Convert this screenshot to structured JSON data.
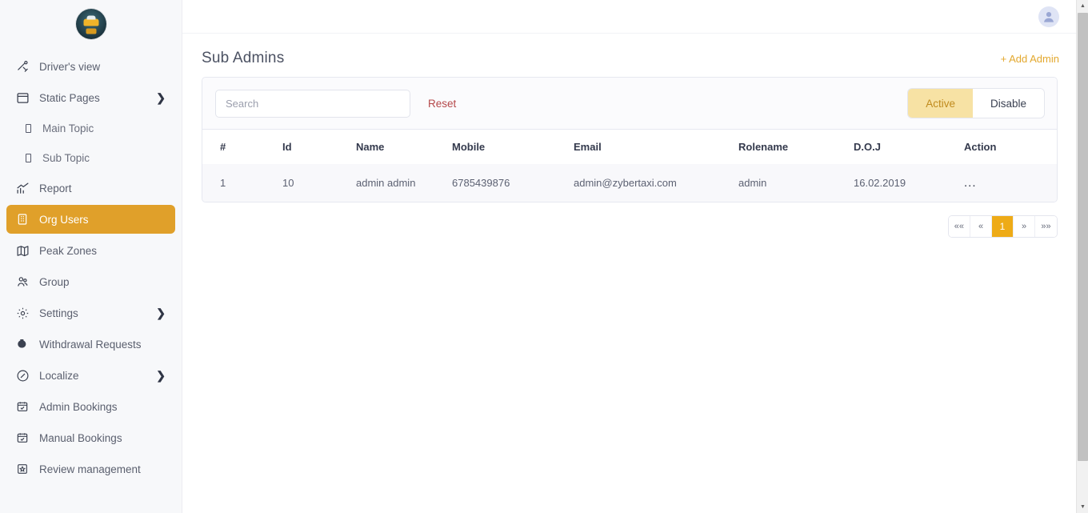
{
  "sidebar": {
    "logo_alt": "taxi-logo",
    "items": [
      {
        "label": "Driver's view",
        "icon": "driver-icon",
        "active": false,
        "expandable": false
      },
      {
        "label": "Static Pages",
        "icon": "pages-icon",
        "active": false,
        "expandable": true
      },
      {
        "label": "Main Topic",
        "icon": "topic-icon",
        "sub": true
      },
      {
        "label": "Sub Topic",
        "icon": "topic-icon",
        "sub": true
      },
      {
        "label": "Report",
        "icon": "chart-icon",
        "active": false,
        "expandable": false
      },
      {
        "label": "Org Users",
        "icon": "building-icon",
        "active": true,
        "expandable": false
      },
      {
        "label": "Peak Zones",
        "icon": "map-icon",
        "active": false,
        "expandable": false
      },
      {
        "label": "Group",
        "icon": "group-icon",
        "active": false,
        "expandable": false
      },
      {
        "label": "Settings",
        "icon": "gear-icon",
        "active": false,
        "expandable": true
      },
      {
        "label": "Withdrawal Requests",
        "icon": "withdrawal-icon",
        "active": false,
        "expandable": false
      },
      {
        "label": "Localize",
        "icon": "compass-icon",
        "active": false,
        "expandable": true
      },
      {
        "label": "Admin Bookings",
        "icon": "calendar-icon",
        "active": false,
        "expandable": false
      },
      {
        "label": "Manual Bookings",
        "icon": "calendar-icon",
        "active": false,
        "expandable": false
      },
      {
        "label": "Review management",
        "icon": "review-icon",
        "active": false,
        "expandable": false
      }
    ]
  },
  "topbar": {
    "avatar_icon": "user-avatar-icon"
  },
  "page": {
    "title": "Sub Admins",
    "add_label": "+ Add Admin"
  },
  "toolbar": {
    "search_placeholder": "Search",
    "search_value": "",
    "reset_label": "Reset",
    "status_toggle": {
      "active_label": "Active",
      "disable_label": "Disable",
      "selected": "Active"
    }
  },
  "table": {
    "columns": [
      "#",
      "Id",
      "Name",
      "Mobile",
      "Email",
      "Rolename",
      "D.O.J",
      "Action"
    ],
    "rows": [
      {
        "index": "1",
        "id": "10",
        "name": "admin admin",
        "mobile": "6785439876",
        "email": "admin@zybertaxi.com",
        "rolename": "admin",
        "doj": "16.02.2019",
        "action": "..."
      }
    ]
  },
  "pagination": {
    "first_label": "««",
    "prev_label": "«",
    "current_page": "1",
    "next_label": "»",
    "last_label": "»»"
  },
  "colors": {
    "accent": "#e0a02a",
    "accent_link": "#e3a82e",
    "pager_active": "#eeab17",
    "toggle_on_bg": "#f7e2a4",
    "toggle_on_text": "#c08b1e",
    "reset_text": "#b5484a"
  }
}
